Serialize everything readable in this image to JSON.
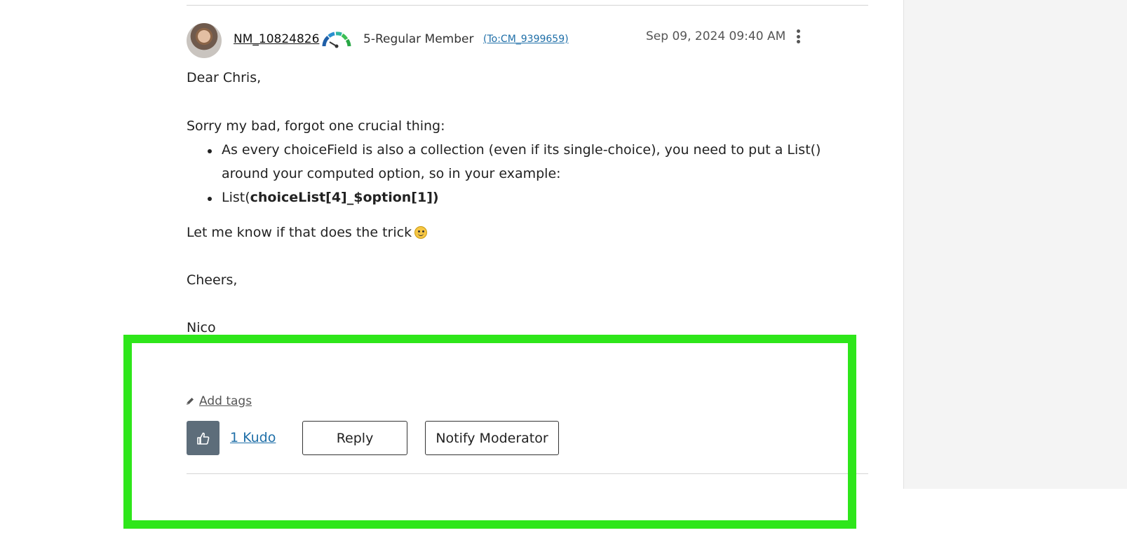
{
  "post": {
    "username": "NM_10824826",
    "rank": "5-Regular Member",
    "to_link": "(To:CM_9399659)",
    "timestamp": "Sep 09, 2024 09:40 AM",
    "greeting": "Dear Chris,",
    "intro": "Sorry my bad, forgot one crucial thing:",
    "bullet1_line1": "As every choiceField is also a collection (even if its single-choice), you need to put a List()",
    "bullet1_line2": "around your computed option, so in your example:",
    "bullet2_prefix": "List(",
    "bullet2_bold": "choiceList[4]_$option[1])",
    "closing": "Let me know if that does the trick",
    "signoff": "Cheers,",
    "signature": "Nico"
  },
  "footer": {
    "add_tags": "Add tags",
    "kudo_count": "1 Kudo",
    "reply": "Reply",
    "notify": "Notify Moderator"
  },
  "colors": {
    "highlight": "#2ee61a",
    "link": "#1f6fa8",
    "kudo_button": "#5d6d7a"
  },
  "icons": [
    "avatar",
    "rank-gauge-icon",
    "kebab-menu-icon",
    "smiley-icon",
    "pencil-icon",
    "thumbs-up-icon"
  ]
}
